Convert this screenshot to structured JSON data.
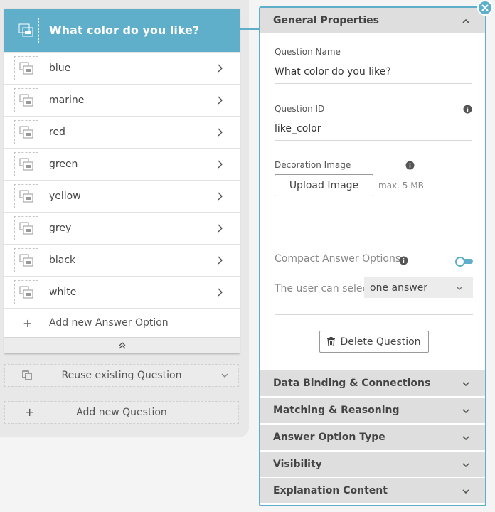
{
  "question": {
    "title": "What color do you like?",
    "answers": [
      {
        "label": "blue"
      },
      {
        "label": "marine"
      },
      {
        "label": "red"
      },
      {
        "label": "green"
      },
      {
        "label": "yellow"
      },
      {
        "label": "grey"
      },
      {
        "label": "black"
      },
      {
        "label": "white"
      }
    ],
    "add_answer_label": "Add new Answer Option",
    "add_answer_icon": "+"
  },
  "actions": {
    "reuse_label": "Reuse existing Question",
    "add_question_label": "Add new Question",
    "add_question_icon": "+"
  },
  "panel": {
    "general_title": "General Properties",
    "question_name_label": "Question Name",
    "question_name_value": "What color do you like?",
    "question_id_label": "Question ID",
    "question_id_value": "like_color",
    "decoration_label": "Decoration Image",
    "upload_label": "Upload Image",
    "max_size": "max. 5 MB",
    "compact_label": "Compact Answer Options",
    "compact_enabled": true,
    "select_label": "The user can select",
    "select_value": "one answer",
    "delete_label": "Delete Question",
    "sections": [
      {
        "title": "Data Binding & Connections"
      },
      {
        "title": "Matching & Reasoning"
      },
      {
        "title": "Answer Option Type"
      },
      {
        "title": "Visibility"
      },
      {
        "title": "Explanation Content"
      }
    ]
  },
  "colors": {
    "accent": "#5fafcb",
    "section_bg": "#dedede"
  },
  "icons": {
    "thumbnail": "image-placeholder-icon",
    "chevron_right": "chevron-right-icon",
    "chevron_down": "chevron-down-icon",
    "chevron_up": "chevron-up-icon",
    "double_up": "double-chevron-up-icon",
    "info": "info-icon",
    "trash": "trash-icon",
    "copy": "copy-icon",
    "close": "close-icon"
  }
}
